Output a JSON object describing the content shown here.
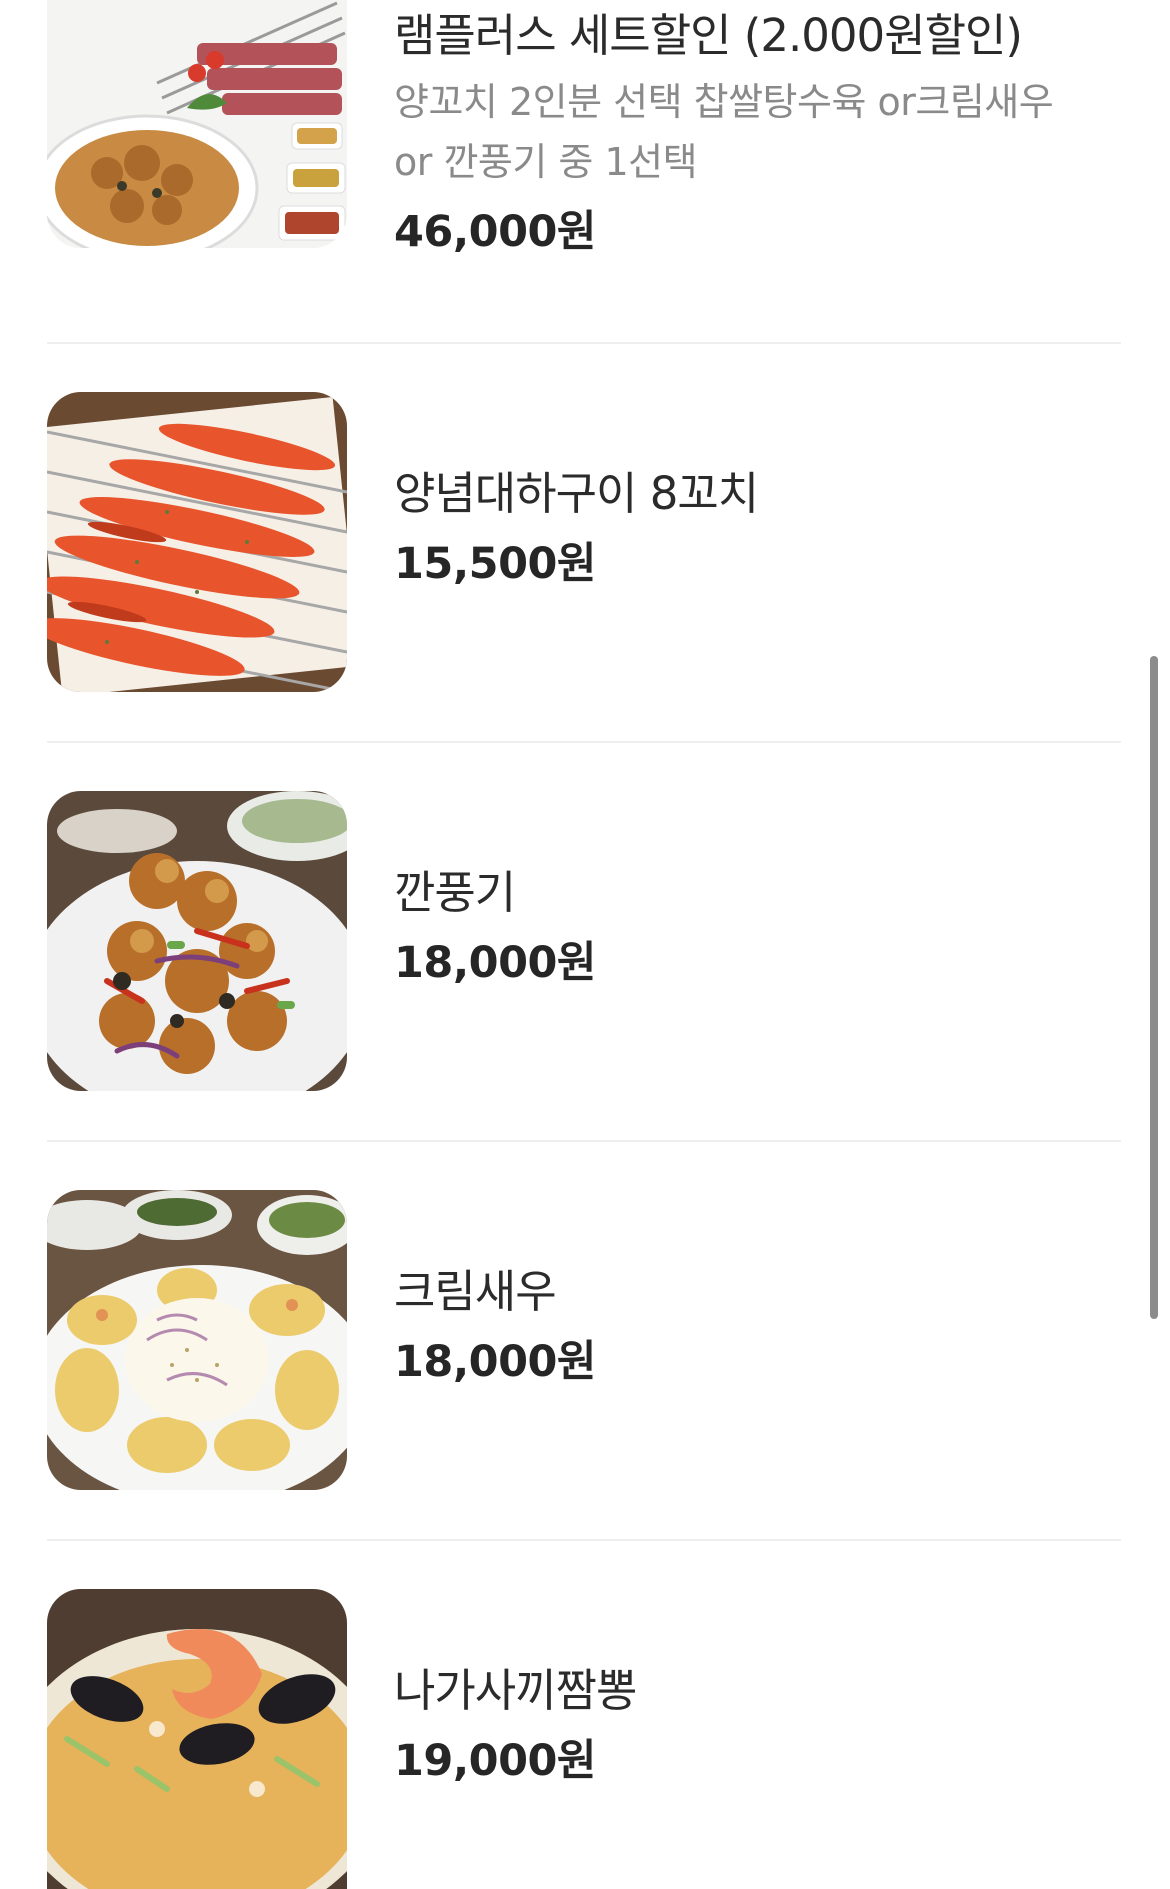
{
  "menu": {
    "items": [
      {
        "name": "램플러스 세트할인 (2.000원할인)",
        "desc_line1": "양꼬치 2인분 선택 찹쌀탕수육 or크림새우",
        "desc_line2": "or 깐풍기 중 1선택",
        "price": "46,000원",
        "image_icon": "lamb-skewer-set-photo"
      },
      {
        "name": "양념대하구이 8꼬치",
        "price": "15,500원",
        "image_icon": "grilled-prawn-skewers-photo"
      },
      {
        "name": "깐풍기",
        "price": "18,000원",
        "image_icon": "kkanpunggi-photo"
      },
      {
        "name": "크림새우",
        "price": "18,000원",
        "image_icon": "cream-shrimp-photo"
      },
      {
        "name": "나가사끼짬뽕",
        "price": "19,000원",
        "image_icon": "nagasaki-jjamppong-photo"
      }
    ]
  },
  "colors": {
    "text_primary": "#2b2b2b",
    "text_secondary": "#8a8a8a",
    "divider": "#eeeeee",
    "scrollbar": "#8c8c8c"
  }
}
